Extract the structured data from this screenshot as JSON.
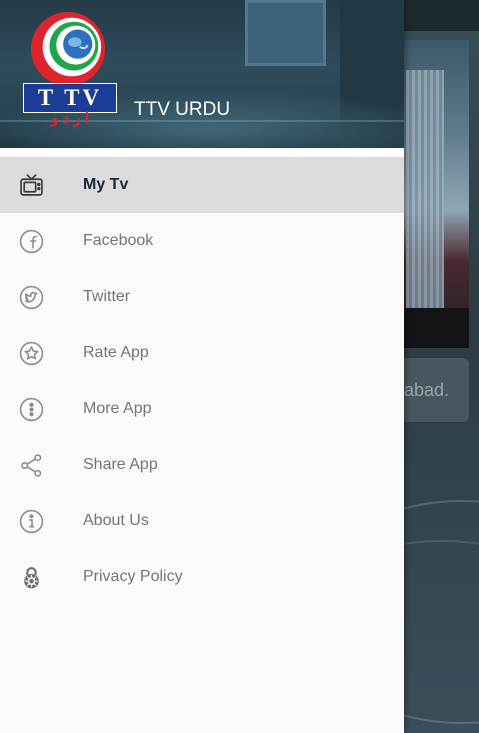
{
  "header": {
    "title": "TTV URDU",
    "logo_text": "T TV",
    "logo_urdu": "ا ر د و"
  },
  "menu": {
    "items": [
      {
        "label": "My Tv",
        "icon": "tv-icon",
        "active": true
      },
      {
        "label": "Facebook",
        "icon": "facebook-icon"
      },
      {
        "label": "Twitter",
        "icon": "twitter-icon"
      },
      {
        "label": "Rate App",
        "icon": "star-icon"
      },
      {
        "label": "More App",
        "icon": "more-icon"
      },
      {
        "label": "Share App",
        "icon": "share-icon"
      },
      {
        "label": "About Us",
        "icon": "info-icon"
      },
      {
        "label": "Privacy Policy",
        "icon": "lock-icon"
      }
    ]
  },
  "background": {
    "card_text": "abad."
  },
  "colors": {
    "active_row": "#dcdcdc",
    "active_text": "#17283a",
    "item_text": "#757575",
    "icon_gray": "#8a8a8a",
    "logo_blue": "#1b3c97",
    "logo_red": "#e0242e",
    "logo_green": "#1fa64a"
  }
}
